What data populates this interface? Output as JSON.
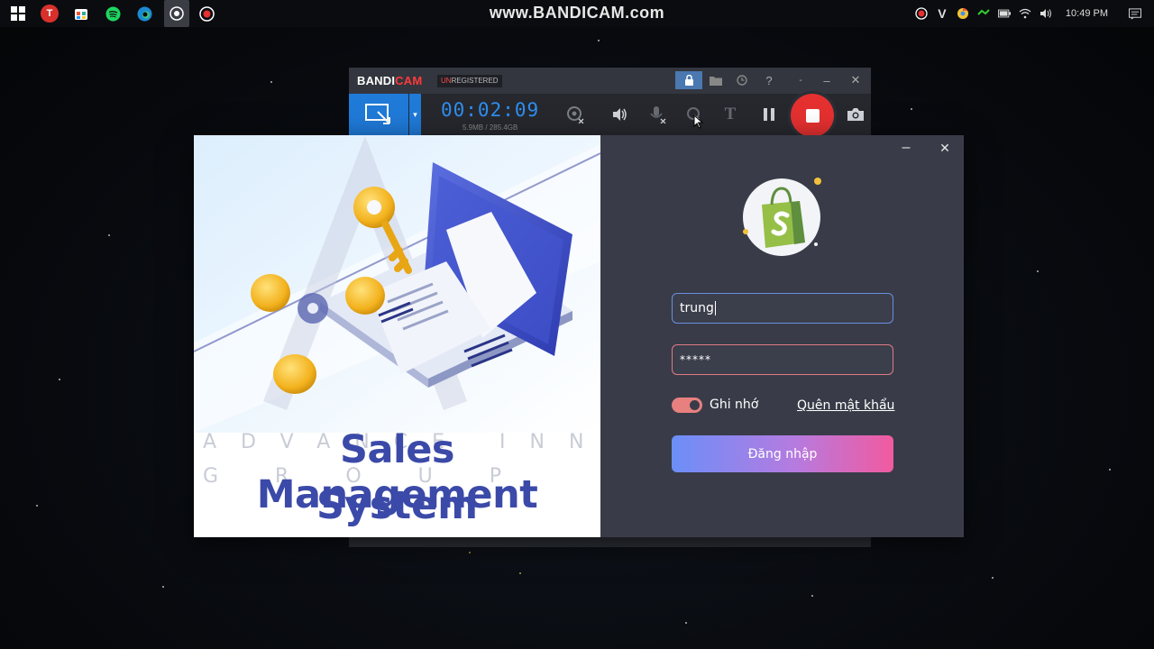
{
  "watermark": "www.BANDICAM.com",
  "taskbar": {
    "apps": [
      "windows-start",
      "todoist",
      "store-app",
      "spotify",
      "edge",
      "bandicam",
      "record-app"
    ],
    "clock": "10:49 PM"
  },
  "bandicam": {
    "brand_a": "BANDI",
    "brand_b": "CAM",
    "unregistered_a": "UN",
    "unregistered_b": "REGISTERED",
    "timer": "00:02:09",
    "size": "5.9MB / 285.4GB"
  },
  "login": {
    "username_value": "trung",
    "password_value": "*****",
    "remember_label": "Ghi nhớ",
    "forgot_label": "Quên mật khẩu",
    "login_button": "Đăng nhập",
    "minimize": "–",
    "close": "✕"
  },
  "brand": {
    "line1": "Sales Management",
    "line2": "System",
    "faint1": "ADVANCE INNOVATION",
    "faint2": "GROUP"
  },
  "colors": {
    "dialog_bg": "#393c48",
    "accent_blue": "#6b8ff8",
    "accent_pink": "#f15aa0",
    "brand_text": "#3b4aa8",
    "record_red": "#e53030"
  }
}
